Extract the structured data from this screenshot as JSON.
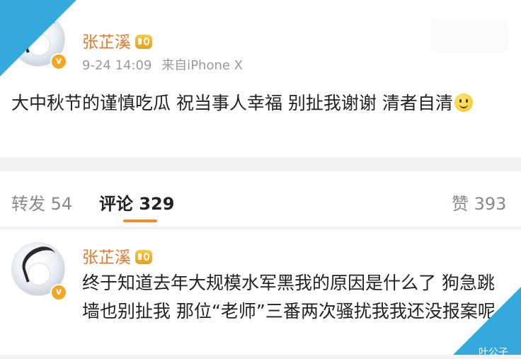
{
  "post": {
    "username": "张芷溪",
    "date": "9-24 14:09",
    "source": "来自iPhone X",
    "text": "大中秋节的谨慎吃瓜 祝当事人幸福 别扯我谢谢 清者自清",
    "verified_badge": "v",
    "crown_icon": "vip-crown-icon",
    "emoji": "smile-emoji-icon"
  },
  "tabs": {
    "repost_label": "转发",
    "repost_count": "54",
    "comment_label": "评论",
    "comment_count": "329",
    "like_label": "赞",
    "like_count": "393",
    "active": "comment"
  },
  "comment": {
    "username": "张芷溪",
    "verified_badge": "v",
    "text": "终于知道去年大规模水军黑我的原因是什么了 狗急跳墙也别扯我 那位“老师”三番两次骚扰我我还没报案呢"
  },
  "watermark": "叶公子",
  "colors": {
    "username": "#e8772e",
    "accent_underline": "#f08c30",
    "corner": "#36a9dc",
    "badge": "#f5a623"
  }
}
